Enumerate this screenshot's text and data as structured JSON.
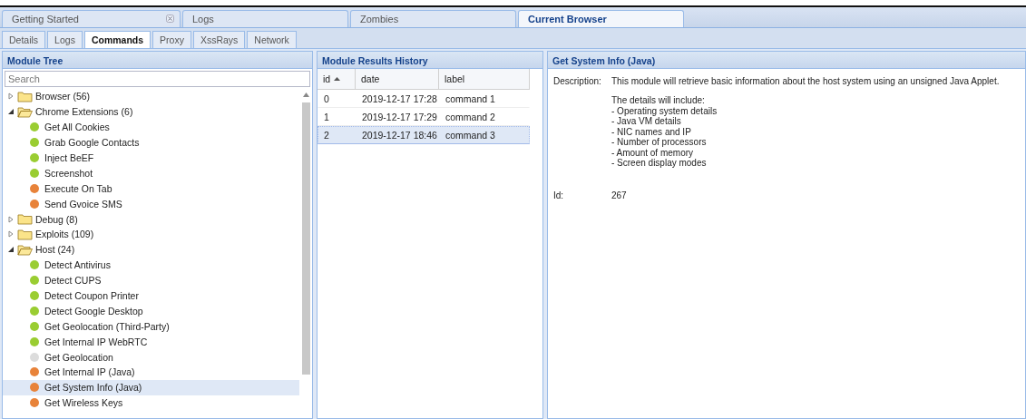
{
  "main_tabs": [
    {
      "label": "Getting Started",
      "selected": false,
      "closable": true
    },
    {
      "label": "Logs",
      "selected": false,
      "closable": false
    },
    {
      "label": "Zombies",
      "selected": false,
      "closable": false
    },
    {
      "label": "Current Browser",
      "selected": true,
      "closable": false
    }
  ],
  "sub_tabs": [
    {
      "label": "Details",
      "selected": false
    },
    {
      "label": "Logs",
      "selected": false
    },
    {
      "label": "Commands",
      "selected": true
    },
    {
      "label": "Proxy",
      "selected": false
    },
    {
      "label": "XssRays",
      "selected": false
    },
    {
      "label": "Network",
      "selected": false
    }
  ],
  "module_tree": {
    "title": "Module Tree",
    "search": {
      "placeholder": "Search"
    },
    "items": [
      {
        "label": "Browser (56)",
        "expanded": false
      },
      {
        "label": "Chrome Extensions (6)",
        "expanded": true,
        "children": [
          {
            "label": "Get All Cookies",
            "color": "#9acd32",
            "selected": false
          },
          {
            "label": "Grab Google Contacts",
            "color": "#9acd32",
            "selected": false
          },
          {
            "label": "Inject BeEF",
            "color": "#9acd32",
            "selected": false
          },
          {
            "label": "Screenshot",
            "color": "#9acd32",
            "selected": false
          },
          {
            "label": "Execute On Tab",
            "color": "#e8833a",
            "selected": false
          },
          {
            "label": "Send Gvoice SMS",
            "color": "#e8833a",
            "selected": false
          }
        ]
      },
      {
        "label": "Debug (8)",
        "expanded": false
      },
      {
        "label": "Exploits (109)",
        "expanded": false
      },
      {
        "label": "Host (24)",
        "expanded": true,
        "children": [
          {
            "label": "Detect Antivirus",
            "color": "#9acd32",
            "selected": false
          },
          {
            "label": "Detect CUPS",
            "color": "#9acd32",
            "selected": false
          },
          {
            "label": "Detect Coupon Printer",
            "color": "#9acd32",
            "selected": false
          },
          {
            "label": "Detect Google Desktop",
            "color": "#9acd32",
            "selected": false
          },
          {
            "label": "Get Geolocation (Third-Party)",
            "color": "#9acd32",
            "selected": false
          },
          {
            "label": "Get Internal IP WebRTC",
            "color": "#9acd32",
            "selected": false
          },
          {
            "label": "Get Geolocation",
            "color": "#dcdcdc",
            "selected": false
          },
          {
            "label": "Get Internal IP (Java)",
            "color": "#e8833a",
            "selected": false
          },
          {
            "label": "Get System Info (Java)",
            "color": "#e8833a",
            "selected": true
          },
          {
            "label": "Get Wireless Keys",
            "color": "#e8833a",
            "selected": false
          }
        ]
      }
    ]
  },
  "results": {
    "title": "Module Results History",
    "columns": [
      {
        "label": "id",
        "sorted": true
      },
      {
        "label": "date",
        "sorted": false
      },
      {
        "label": "label",
        "sorted": false
      }
    ],
    "rows": [
      {
        "cells": [
          "0",
          "2019-12-17 17:28",
          "command 1"
        ],
        "selected": false
      },
      {
        "cells": [
          "1",
          "2019-12-17 17:29",
          "command 2"
        ],
        "selected": false
      },
      {
        "cells": [
          "2",
          "2019-12-17 18:46",
          "command 3"
        ],
        "selected": true
      }
    ]
  },
  "details": {
    "title": "Get System Info (Java)",
    "description_label": "Description:",
    "summary": "This module will retrieve basic information about the host system using an unsigned Java Applet.",
    "details_heading": "The details will include:",
    "details": [
      "- Operating system details",
      "- Java VM details",
      "- NIC names and IP",
      "- Number of processors",
      "- Amount of memory",
      "- Screen display modes"
    ],
    "id_label": "Id:",
    "id": "267"
  }
}
